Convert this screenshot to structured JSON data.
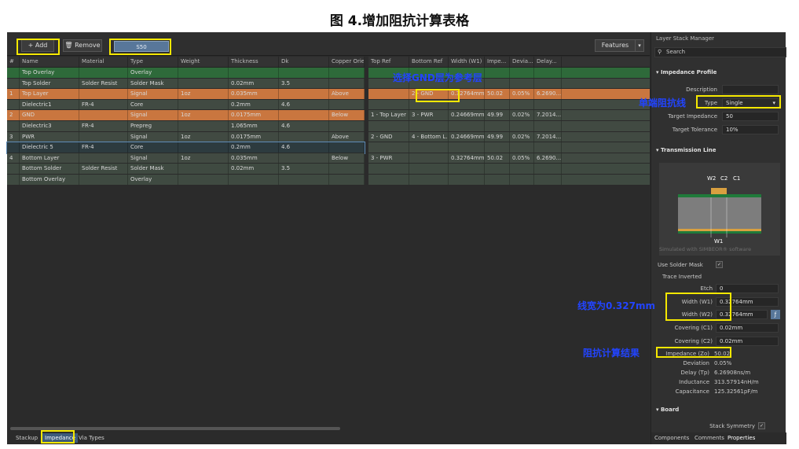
{
  "doc_title": "图 4.增加阻抗计算表格",
  "toolbar": {
    "add": "+ Add",
    "remove": "Remove",
    "layer": "S50",
    "features": "Features"
  },
  "left_headers": [
    "#",
    "Name",
    "Material",
    "Type",
    "Weight",
    "Thickness",
    "Dk",
    "Copper Orie"
  ],
  "left_rows": [
    {
      "num": "",
      "name": "Top Overlay",
      "material": "",
      "type": "Overlay",
      "weight": "",
      "thickness": "",
      "dk": "",
      "orient": "",
      "style": "r-green"
    },
    {
      "num": "",
      "name": "Top Solder",
      "material": "Solder Resist",
      "type": "Solder Mask",
      "weight": "",
      "thickness": "0.02mm",
      "dk": "3.5",
      "orient": "",
      "style": "r-dark"
    },
    {
      "num": "1",
      "name": "Top Layer",
      "material": "",
      "type": "Signal",
      "weight": "1oz",
      "thickness": "0.035mm",
      "dk": "",
      "orient": "Above",
      "style": "r-orange"
    },
    {
      "num": "",
      "name": "Dielectric1",
      "material": "FR-4",
      "type": "Core",
      "weight": "",
      "thickness": "0.2mm",
      "dk": "4.6",
      "orient": "",
      "style": "r-core"
    },
    {
      "num": "2",
      "name": "GND",
      "material": "",
      "type": "Signal",
      "weight": "1oz",
      "thickness": "0.0175mm",
      "dk": "",
      "orient": "Below",
      "style": "r-orange"
    },
    {
      "num": "",
      "name": "Dielectric3",
      "material": "FR-4",
      "type": "Prepreg",
      "weight": "",
      "thickness": "1.065mm",
      "dk": "4.6",
      "orient": "",
      "style": "r-core"
    },
    {
      "num": "3",
      "name": "PWR",
      "material": "",
      "type": "Signal",
      "weight": "1oz",
      "thickness": "0.0175mm",
      "dk": "",
      "orient": "Above",
      "style": "r-core"
    },
    {
      "num": "",
      "name": "Dielectric 5",
      "material": "FR-4",
      "type": "Core",
      "weight": "",
      "thickness": "0.2mm",
      "dk": "4.6",
      "orient": "",
      "style": "r-sel"
    },
    {
      "num": "4",
      "name": "Bottom Layer",
      "material": "",
      "type": "Signal",
      "weight": "1oz",
      "thickness": "0.035mm",
      "dk": "",
      "orient": "Below",
      "style": "r-core"
    },
    {
      "num": "",
      "name": "Bottom Solder",
      "material": "Solder Resist",
      "type": "Solder Mask",
      "weight": "",
      "thickness": "0.02mm",
      "dk": "3.5",
      "orient": "",
      "style": "r-dark"
    },
    {
      "num": "",
      "name": "Bottom Overlay",
      "material": "",
      "type": "Overlay",
      "weight": "",
      "thickness": "",
      "dk": "",
      "orient": "",
      "style": "r-dark"
    }
  ],
  "right_headers": [
    "Top Ref",
    "Bottom Ref",
    "Width (W1)",
    "Impe...",
    "Devia...",
    "Delay..."
  ],
  "right_rows": [
    {
      "top": "",
      "bottom": "",
      "width": "",
      "imp": "",
      "dev": "",
      "delay": "",
      "style": "r-green"
    },
    {
      "top": "",
      "bottom": "",
      "width": "",
      "imp": "",
      "dev": "",
      "delay": "",
      "style": "r-dark"
    },
    {
      "top": "",
      "bottom": "2 - GND",
      "width": "0.32764mm",
      "imp": "50.02",
      "dev": "0.05%",
      "delay": "6.2690...",
      "style": "r-orange"
    },
    {
      "top": "",
      "bottom": "",
      "width": "",
      "imp": "",
      "dev": "",
      "delay": "",
      "style": "r-core"
    },
    {
      "top": "1 - Top Layer",
      "bottom": "3 - PWR",
      "width": "0.24669mm",
      "imp": "49.99",
      "dev": "0.02%",
      "delay": "7.2014...",
      "style": "r-core"
    },
    {
      "top": "",
      "bottom": "",
      "width": "",
      "imp": "",
      "dev": "",
      "delay": "",
      "style": "r-core"
    },
    {
      "top": "2 - GND",
      "bottom": "4 - Bottom L...",
      "width": "0.24669mm",
      "imp": "49.99",
      "dev": "0.02%",
      "delay": "7.2014...",
      "style": "r-core"
    },
    {
      "top": "",
      "bottom": "",
      "width": "",
      "imp": "",
      "dev": "",
      "delay": "",
      "style": "r-core"
    },
    {
      "top": "3 - PWR",
      "bottom": "",
      "width": "0.32764mm",
      "imp": "50.02",
      "dev": "0.05%",
      "delay": "6.2690...",
      "style": "r-core"
    },
    {
      "top": "",
      "bottom": "",
      "width": "",
      "imp": "",
      "dev": "",
      "delay": "",
      "style": "r-dark"
    },
    {
      "top": "",
      "bottom": "",
      "width": "",
      "imp": "",
      "dev": "",
      "delay": "",
      "style": "r-dark"
    }
  ],
  "panel": {
    "title": "Layer Stack Manager",
    "search": "Search",
    "impedance_profile": "Impedance Profile",
    "description_lbl": "Description",
    "type_lbl": "Type",
    "type_val": "Single",
    "target_imp_lbl": "Target Impedance",
    "target_imp_val": "50",
    "target_tol_lbl": "Target Tolerance",
    "target_tol_val": "10%",
    "transmission_line": "Transmission Line",
    "diagram_w2": "W2",
    "diagram_c2": "C2",
    "diagram_c1": "C1",
    "diagram_w1": "W1",
    "simulated": "Simulated with SIMBEOR® software",
    "use_solder_mask": "Use Solder Mask",
    "trace_inverted": "Trace Inverted",
    "etch_lbl": "Etch",
    "etch_val": "0",
    "w1_lbl": "Width (W1)",
    "w1_val": "0.32764mm",
    "w2_lbl": "Width (W2)",
    "w2_val": "0.32764mm",
    "c1_lbl": "Covering (C1)",
    "c1_val": "0.02mm",
    "c2_lbl": "Covering (C2)",
    "c2_val": "0.02mm",
    "imp_lbl": "Impedance (Zo)",
    "imp_val": "50.02",
    "dev_lbl": "Deviation",
    "dev_val": "0.05%",
    "delay_lbl": "Delay (Tp)",
    "delay_val": "6.26908ns/m",
    "ind_lbl": "Inductance",
    "ind_val": "313.57914nH/m",
    "cap_lbl": "Capacitance",
    "cap_val": "125.32561pF/m",
    "board": "Board",
    "stack_sym": "Stack Symmetry",
    "tabs": [
      "Components",
      "Comments",
      "Properties"
    ]
  },
  "tabs": [
    "Stackup",
    "Impedance",
    "Via Types"
  ],
  "annotations": {
    "gnd_ref": "选择GND层为参考层",
    "single": "单端阻抗线",
    "width": "线宽为0.327mm",
    "result": "阻抗计算结果"
  },
  "colors": {
    "annotation": "#2244ff",
    "highlight": "#f5e800"
  }
}
